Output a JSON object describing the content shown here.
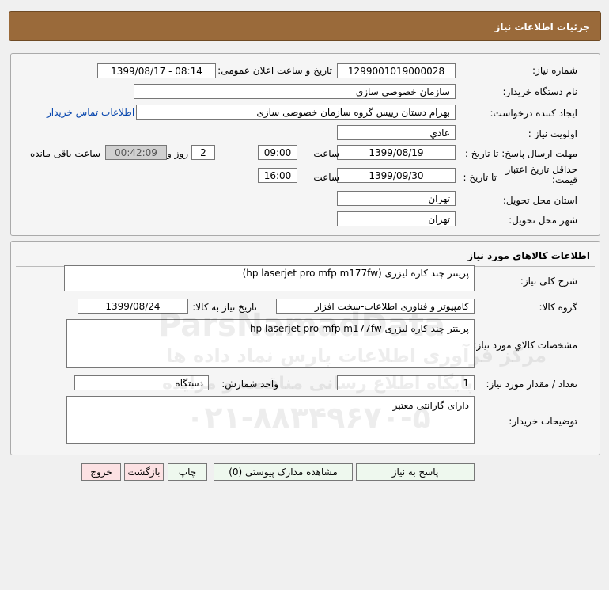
{
  "header": {
    "title": "جزئیات اطلاعات نیاز"
  },
  "info": {
    "need_number_label": "شماره نیاز:",
    "need_number": "1299001019000028",
    "announce_label": "تاریخ و ساعت اعلان عمومی:",
    "announce_value": "1399/08/17 - 08:14",
    "buyer_org_label": "نام دستگاه خریدار:",
    "buyer_org": "سازمان خصوصی سازی",
    "requester_label": "ایجاد کننده درخواست:",
    "requester": "بهرام دستان رییس گروه سازمان خصوصی سازی",
    "contact_link": "اطلاعات تماس خریدار",
    "priority_label": "اولویت نیاز :",
    "priority": "عادي",
    "deadline_label": "مهلت ارسال پاسخ: تا تاریخ :",
    "deadline_date": "1399/08/19",
    "time_label": "ساعت",
    "deadline_time": "09:00",
    "days_value": "2",
    "days_label": "روز و",
    "remaining_time": "00:42:09",
    "remaining_label": "ساعت باقی مانده",
    "validity_label": "حداقل تاریخ اعتبار قیمت:",
    "validity_to_label": "تا تاریخ :",
    "validity_date": "1399/09/30",
    "validity_time": "16:00",
    "province_label": "استان محل تحویل:",
    "province": "تهران",
    "city_label": "شهر محل تحویل:",
    "city": "تهران"
  },
  "goods": {
    "section_title": "اطلاعات کالاهای مورد نیاز",
    "summary_label": "شرح کلی نیاز:",
    "summary": "پرینتر چند کاره لیزری   (hp laserjet pro mfp m177fw)",
    "group_label": "گروه کالا:",
    "group": "کامپیوتر و فناوری اطلاعات-سخت افزار",
    "need_date_label": "تاریخ نیاز به کالا:",
    "need_date": "1399/08/24",
    "specs_label": "مشخصات کالاي مورد نیاز:",
    "specs": "پرینتر چند کاره لیزری   hp laserjet pro mfp m177fw",
    "qty_label": "تعداد / مقدار مورد نیاز:",
    "qty": "1",
    "unit_label": "واحد شمارش:",
    "unit": "دستگاه",
    "notes_label": "توضیحات خریدار:",
    "notes": "دارای گارانتی معتبر"
  },
  "buttons": {
    "reply": "پاسخ به نیاز",
    "attachments": "مشاهده مدارک پیوستی (0)",
    "print": "چاپ",
    "back": "بازگشت",
    "exit": "خروج"
  },
  "watermark": {
    "brand": "ParsNamadData",
    "tagline1": "مرکز فرآوری اطلاعات پارس نماد داده ها",
    "tagline2": "پایگاه اطلاع رسانی مناقصه و مزایده",
    "phone": "۰۲۱-۸۸۳۴۹۶۷۰-۵"
  }
}
